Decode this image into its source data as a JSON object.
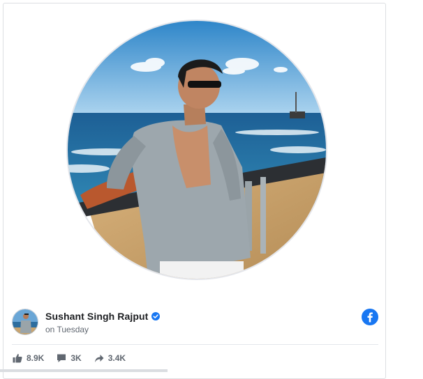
{
  "post": {
    "author_name": "Sushant Singh Rajput",
    "timestamp": "on Tuesday",
    "verified": true,
    "platform_icon": "facebook-icon",
    "image_subject": "profile photo"
  },
  "stats": {
    "likes": "8.9K",
    "comments": "3K",
    "shares": "3.4K"
  },
  "icons": {
    "like": "thumbs-up-icon",
    "comment": "comment-icon",
    "share": "share-arrow-icon",
    "verified": "verified-badge-icon"
  },
  "colors": {
    "facebook_blue": "#1877f2",
    "name_text": "#1c1e21",
    "muted_text": "#606770",
    "divider": "#e4e6eb"
  }
}
